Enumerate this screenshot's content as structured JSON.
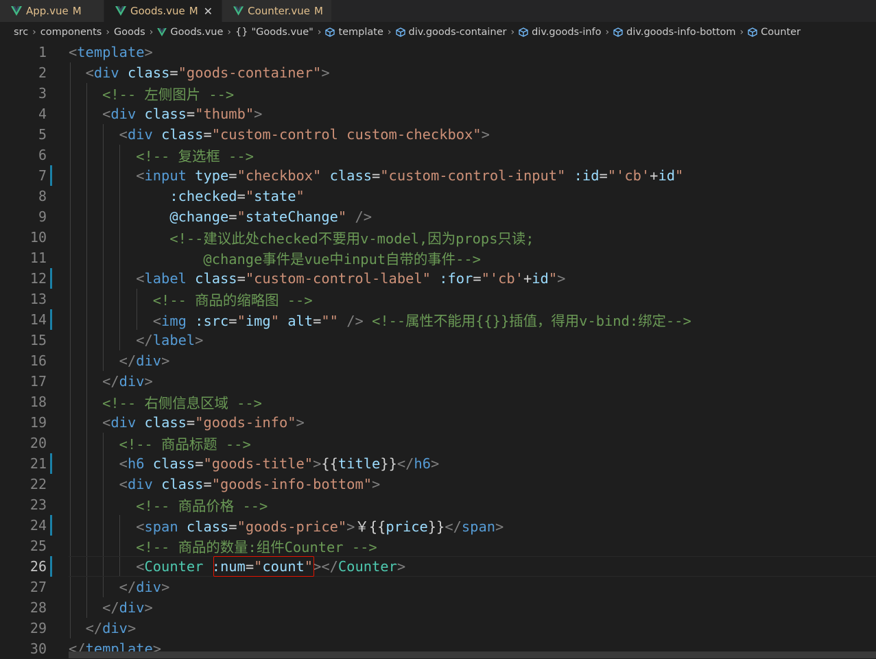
{
  "tabs": [
    {
      "name": "App.vue",
      "status": "M"
    },
    {
      "name": "Goods.vue",
      "status": "M",
      "close": "✕",
      "active": true
    },
    {
      "name": "Counter.vue",
      "status": "M"
    }
  ],
  "breadcrumb": [
    "src",
    "components",
    "Goods",
    "Goods.vue",
    "\"Goods.vue\"",
    "template",
    "div.goods-container",
    "div.goods-info",
    "div.goods-info-bottom",
    "Counter"
  ],
  "editor": {
    "current_line": 26,
    "lines": [
      {
        "n": "1"
      },
      {
        "n": "2"
      },
      {
        "n": "3"
      },
      {
        "n": "4"
      },
      {
        "n": "5"
      },
      {
        "n": "6"
      },
      {
        "n": "7"
      },
      {
        "n": "8"
      },
      {
        "n": "9"
      },
      {
        "n": "10"
      },
      {
        "n": "11"
      },
      {
        "n": "12"
      },
      {
        "n": "13"
      },
      {
        "n": "14"
      },
      {
        "n": "15"
      },
      {
        "n": "16"
      },
      {
        "n": "17"
      },
      {
        "n": "18"
      },
      {
        "n": "19"
      },
      {
        "n": "20"
      },
      {
        "n": "21"
      },
      {
        "n": "22"
      },
      {
        "n": "23"
      },
      {
        "n": "24"
      },
      {
        "n": "25"
      },
      {
        "n": "26"
      },
      {
        "n": "27"
      },
      {
        "n": "28"
      },
      {
        "n": "29"
      },
      {
        "n": "30"
      }
    ],
    "code": [
      [
        [
          "p",
          "<"
        ],
        [
          "g",
          "template"
        ],
        [
          "p",
          ">"
        ]
      ],
      [
        [
          "w",
          "  "
        ],
        [
          "p",
          "<"
        ],
        [
          "g",
          "div"
        ],
        [
          "w",
          " "
        ],
        [
          "a",
          "class"
        ],
        [
          "w",
          "="
        ],
        [
          "s",
          "\"goods-container\""
        ],
        [
          "p",
          ">"
        ]
      ],
      [
        [
          "w",
          "    "
        ],
        [
          "c",
          "<!-- 左侧图片 -->"
        ]
      ],
      [
        [
          "w",
          "    "
        ],
        [
          "p",
          "<"
        ],
        [
          "g",
          "div"
        ],
        [
          "w",
          " "
        ],
        [
          "a",
          "class"
        ],
        [
          "w",
          "="
        ],
        [
          "s",
          "\"thumb\""
        ],
        [
          "p",
          ">"
        ]
      ],
      [
        [
          "w",
          "      "
        ],
        [
          "p",
          "<"
        ],
        [
          "g",
          "div"
        ],
        [
          "w",
          " "
        ],
        [
          "a",
          "class"
        ],
        [
          "w",
          "="
        ],
        [
          "s",
          "\"custom-control custom-checkbox\""
        ],
        [
          "p",
          ">"
        ]
      ],
      [
        [
          "w",
          "        "
        ],
        [
          "c",
          "<!-- 复选框 -->"
        ]
      ],
      [
        [
          "w",
          "        "
        ],
        [
          "p",
          "<"
        ],
        [
          "g",
          "input"
        ],
        [
          "w",
          " "
        ],
        [
          "a",
          "type"
        ],
        [
          "w",
          "="
        ],
        [
          "s",
          "\"checkbox\""
        ],
        [
          "w",
          " "
        ],
        [
          "a",
          "class"
        ],
        [
          "w",
          "="
        ],
        [
          "s",
          "\"custom-control-input\""
        ],
        [
          "w",
          " "
        ],
        [
          "a",
          ":id"
        ],
        [
          "w",
          "="
        ],
        [
          "s",
          "\""
        ],
        [
          "s",
          "'cb'"
        ],
        [
          "t",
          "+"
        ],
        [
          "a",
          "id"
        ],
        [
          "s",
          "\""
        ]
      ],
      [
        [
          "w",
          "            "
        ],
        [
          "a",
          ":checked"
        ],
        [
          "w",
          "="
        ],
        [
          "s",
          "\""
        ],
        [
          "a",
          "state"
        ],
        [
          "s",
          "\""
        ]
      ],
      [
        [
          "w",
          "            "
        ],
        [
          "a",
          "@change"
        ],
        [
          "w",
          "="
        ],
        [
          "s",
          "\""
        ],
        [
          "a",
          "stateChange"
        ],
        [
          "s",
          "\""
        ],
        [
          "w",
          " "
        ],
        [
          "p",
          "/>"
        ]
      ],
      [
        [
          "w",
          "            "
        ],
        [
          "c",
          "<!--建议此处checked不要用v-model,因为props只读;"
        ]
      ],
      [
        [
          "w",
          "                "
        ],
        [
          "c",
          "@change事件是vue中input自带的事件-->"
        ]
      ],
      [
        [
          "w",
          "        "
        ],
        [
          "p",
          "<"
        ],
        [
          "g",
          "label"
        ],
        [
          "w",
          " "
        ],
        [
          "a",
          "class"
        ],
        [
          "w",
          "="
        ],
        [
          "s",
          "\"custom-control-label\""
        ],
        [
          "w",
          " "
        ],
        [
          "a",
          ":for"
        ],
        [
          "w",
          "="
        ],
        [
          "s",
          "\""
        ],
        [
          "s",
          "'cb'"
        ],
        [
          "t",
          "+"
        ],
        [
          "a",
          "id"
        ],
        [
          "s",
          "\""
        ],
        [
          "p",
          ">"
        ]
      ],
      [
        [
          "w",
          "          "
        ],
        [
          "c",
          "<!-- 商品的缩略图 -->"
        ]
      ],
      [
        [
          "w",
          "          "
        ],
        [
          "p",
          "<"
        ],
        [
          "g",
          "img"
        ],
        [
          "w",
          " "
        ],
        [
          "a",
          ":src"
        ],
        [
          "w",
          "="
        ],
        [
          "s",
          "\""
        ],
        [
          "a",
          "img"
        ],
        [
          "s",
          "\""
        ],
        [
          "w",
          " "
        ],
        [
          "a",
          "alt"
        ],
        [
          "w",
          "="
        ],
        [
          "s",
          "\"\""
        ],
        [
          "w",
          " "
        ],
        [
          "p",
          "/>"
        ],
        [
          "w",
          " "
        ],
        [
          "c",
          "<!--属性不能用{{}}插值，得用v-bind:绑定-->"
        ]
      ],
      [
        [
          "w",
          "        "
        ],
        [
          "p",
          "</"
        ],
        [
          "g",
          "label"
        ],
        [
          "p",
          ">"
        ]
      ],
      [
        [
          "w",
          "      "
        ],
        [
          "p",
          "</"
        ],
        [
          "g",
          "div"
        ],
        [
          "p",
          ">"
        ]
      ],
      [
        [
          "w",
          "    "
        ],
        [
          "p",
          "</"
        ],
        [
          "g",
          "div"
        ],
        [
          "p",
          ">"
        ]
      ],
      [
        [
          "w",
          "    "
        ],
        [
          "c",
          "<!-- 右侧信息区域 -->"
        ]
      ],
      [
        [
          "w",
          "    "
        ],
        [
          "p",
          "<"
        ],
        [
          "g",
          "div"
        ],
        [
          "w",
          " "
        ],
        [
          "a",
          "class"
        ],
        [
          "w",
          "="
        ],
        [
          "s",
          "\"goods-info\""
        ],
        [
          "p",
          ">"
        ]
      ],
      [
        [
          "w",
          "      "
        ],
        [
          "c",
          "<!-- 商品标题 -->"
        ]
      ],
      [
        [
          "w",
          "      "
        ],
        [
          "p",
          "<"
        ],
        [
          "g",
          "h6"
        ],
        [
          "w",
          " "
        ],
        [
          "a",
          "class"
        ],
        [
          "w",
          "="
        ],
        [
          "s",
          "\"goods-title\""
        ],
        [
          "p",
          ">"
        ],
        [
          "t",
          "{{"
        ],
        [
          "a",
          "title"
        ],
        [
          "t",
          "}}"
        ],
        [
          "p",
          "</"
        ],
        [
          "g",
          "h6"
        ],
        [
          "p",
          ">"
        ]
      ],
      [
        [
          "w",
          "      "
        ],
        [
          "p",
          "<"
        ],
        [
          "g",
          "div"
        ],
        [
          "w",
          " "
        ],
        [
          "a",
          "class"
        ],
        [
          "w",
          "="
        ],
        [
          "s",
          "\"goods-info-bottom\""
        ],
        [
          "p",
          ">"
        ]
      ],
      [
        [
          "w",
          "        "
        ],
        [
          "c",
          "<!-- 商品价格 -->"
        ]
      ],
      [
        [
          "w",
          "        "
        ],
        [
          "p",
          "<"
        ],
        [
          "g",
          "span"
        ],
        [
          "w",
          " "
        ],
        [
          "a",
          "class"
        ],
        [
          "w",
          "="
        ],
        [
          "s",
          "\"goods-price\""
        ],
        [
          "p",
          ">"
        ],
        [
          "t",
          "￥{{"
        ],
        [
          "a",
          "price"
        ],
        [
          "t",
          "}}"
        ],
        [
          "p",
          "</"
        ],
        [
          "g",
          "span"
        ],
        [
          "p",
          ">"
        ]
      ],
      [
        [
          "w",
          "        "
        ],
        [
          "c",
          "<!-- 商品的数量:组件Counter -->"
        ]
      ],
      [
        [
          "w",
          "        "
        ],
        [
          "p",
          "<"
        ],
        [
          "k",
          "Counter"
        ],
        [
          "w",
          " "
        ],
        [
          "a",
          ":num"
        ],
        [
          "w",
          "="
        ],
        [
          "s",
          "\""
        ],
        [
          "a",
          "count"
        ],
        [
          "s",
          "\""
        ],
        [
          "p",
          "></"
        ],
        [
          "k",
          "Counter"
        ],
        [
          "p",
          ">"
        ]
      ],
      [
        [
          "w",
          "      "
        ],
        [
          "p",
          "</"
        ],
        [
          "g",
          "div"
        ],
        [
          "p",
          ">"
        ]
      ],
      [
        [
          "w",
          "    "
        ],
        [
          "p",
          "</"
        ],
        [
          "g",
          "div"
        ],
        [
          "p",
          ">"
        ]
      ],
      [
        [
          "w",
          "  "
        ],
        [
          "p",
          "</"
        ],
        [
          "g",
          "div"
        ],
        [
          "p",
          ">"
        ]
      ],
      [
        [
          "p",
          "</"
        ],
        [
          "g",
          "template"
        ],
        [
          "p",
          ">"
        ]
      ]
    ],
    "modified_lines": [
      7,
      12,
      14,
      21,
      24,
      26
    ]
  },
  "colors": {
    "background": "#1e1e1e",
    "tag": "#569cd6",
    "component": "#4ec9b0",
    "attribute": "#9cdcfe",
    "string": "#ce9178",
    "comment": "#6a9955",
    "highlight_box": "#e51400",
    "vue_icon": "#41b883"
  }
}
